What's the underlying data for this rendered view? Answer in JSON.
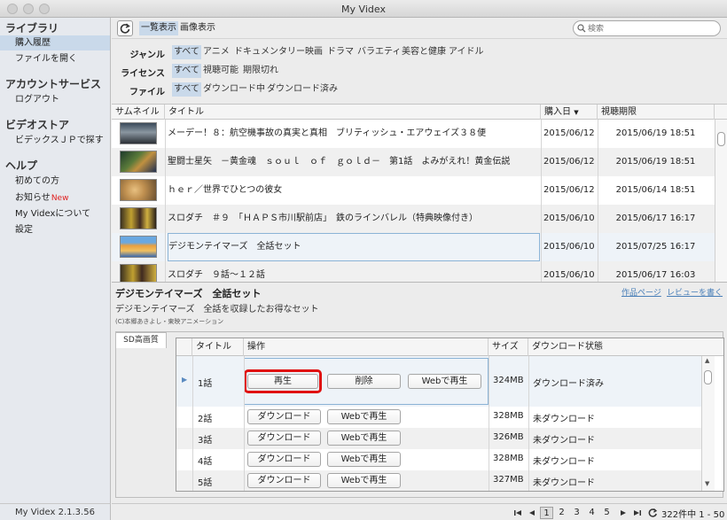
{
  "window": {
    "title": "My Videx"
  },
  "sidebar": {
    "sections": [
      {
        "heading": "ライブラリ",
        "items": [
          {
            "label": "購入履歴",
            "selected": true
          },
          {
            "label": "ファイルを開く"
          }
        ]
      },
      {
        "heading": "アカウントサービス",
        "items": [
          {
            "label": "ログアウト"
          }
        ]
      },
      {
        "heading": "ビデオストア",
        "items": [
          {
            "label": "ビデックスＪＰで探す"
          }
        ]
      },
      {
        "heading": "ヘルプ",
        "items": [
          {
            "label": "初めての方"
          },
          {
            "label": "お知らせ",
            "badge": "New"
          },
          {
            "label": "My Videxについて"
          },
          {
            "label": "設定"
          }
        ]
      }
    ],
    "version": "My Videx 2.1.3.56"
  },
  "toolbar": {
    "view_list": "一覧表示",
    "view_image": "画像表示",
    "search_placeholder": "検索"
  },
  "filters": [
    {
      "label": "ジャンル",
      "options": [
        "すべて",
        "アニメ",
        "ドキュメンタリー",
        "映画",
        "ドラマ",
        "バラエティ",
        "美容と健康",
        "アイドル"
      ]
    },
    {
      "label": "ライセンス",
      "options": [
        "すべて",
        "視聴可能",
        "期限切れ"
      ]
    },
    {
      "label": "ファイル",
      "options": [
        "すべて",
        "ダウンロード中",
        "ダウンロード済み"
      ]
    }
  ],
  "list": {
    "columns": {
      "thumb": "サムネイル",
      "title": "タイトル",
      "purchase": "購入日",
      "expiry": "視聴期限"
    },
    "rows": [
      {
        "title": "メーデー！８：航空機事故の真実と真相　ブリティッシュ・エアウェイズ３８便",
        "purchase": "2015/06/12",
        "expiry": "2015/06/19 18:51"
      },
      {
        "title": "聖闘士星矢　－黄金魂　ｓｏｕｌ　ｏｆ　ｇｏｌｄ－　第1話　よみがえれ！黄金伝説",
        "purchase": "2015/06/12",
        "expiry": "2015/06/19 18:51"
      },
      {
        "title": "ｈｅｒ／世界でひとつの彼女",
        "purchase": "2015/06/12",
        "expiry": "2015/06/14 18:51"
      },
      {
        "title": "スロダチ　＃９　「ＨＡＰＳ市川駅前店」　鉄のラインバレル（特典映像付き）",
        "purchase": "2015/06/10",
        "expiry": "2015/06/17 16:17"
      },
      {
        "title": "デジモンテイマーズ　全話セット",
        "purchase": "2015/06/10",
        "expiry": "2015/07/25 16:17"
      },
      {
        "title": "スロダチ　９話～１２話",
        "purchase": "2015/06/10",
        "expiry": "2015/06/17 16:03"
      }
    ]
  },
  "detail": {
    "title": "デジモンテイマーズ　全話セット",
    "subtitle": "デジモンテイマーズ　全話を収録したお得なセット",
    "copyright": "(C)本郷あきよし・東映アニメーション",
    "link_page": "作品ページ",
    "link_review": "レビューを書く",
    "quality_tab": "SD高画質",
    "episodes": {
      "columns": {
        "title": "タイトル",
        "ops": "操作",
        "size": "サイズ",
        "status": "ダウンロード状態"
      },
      "rows": [
        {
          "title": "1話",
          "buttons": [
            "再生",
            "削除",
            "Webで再生"
          ],
          "size": "324MB",
          "status": "ダウンロード済み"
        },
        {
          "title": "2話",
          "buttons": [
            "ダウンロード",
            "Webで再生"
          ],
          "size": "328MB",
          "status": "未ダウンロード"
        },
        {
          "title": "3話",
          "buttons": [
            "ダウンロード",
            "Webで再生"
          ],
          "size": "326MB",
          "status": "未ダウンロード"
        },
        {
          "title": "4話",
          "buttons": [
            "ダウンロード",
            "Webで再生"
          ],
          "size": "328MB",
          "status": "未ダウンロード"
        },
        {
          "title": "5話",
          "buttons": [
            "ダウンロード",
            "Webで再生"
          ],
          "size": "327MB",
          "status": "未ダウンロード"
        }
      ]
    }
  },
  "pagination": {
    "pages": [
      "1",
      "2",
      "3",
      "4",
      "5"
    ],
    "current": "1",
    "range": "322件中 1 - 50"
  }
}
